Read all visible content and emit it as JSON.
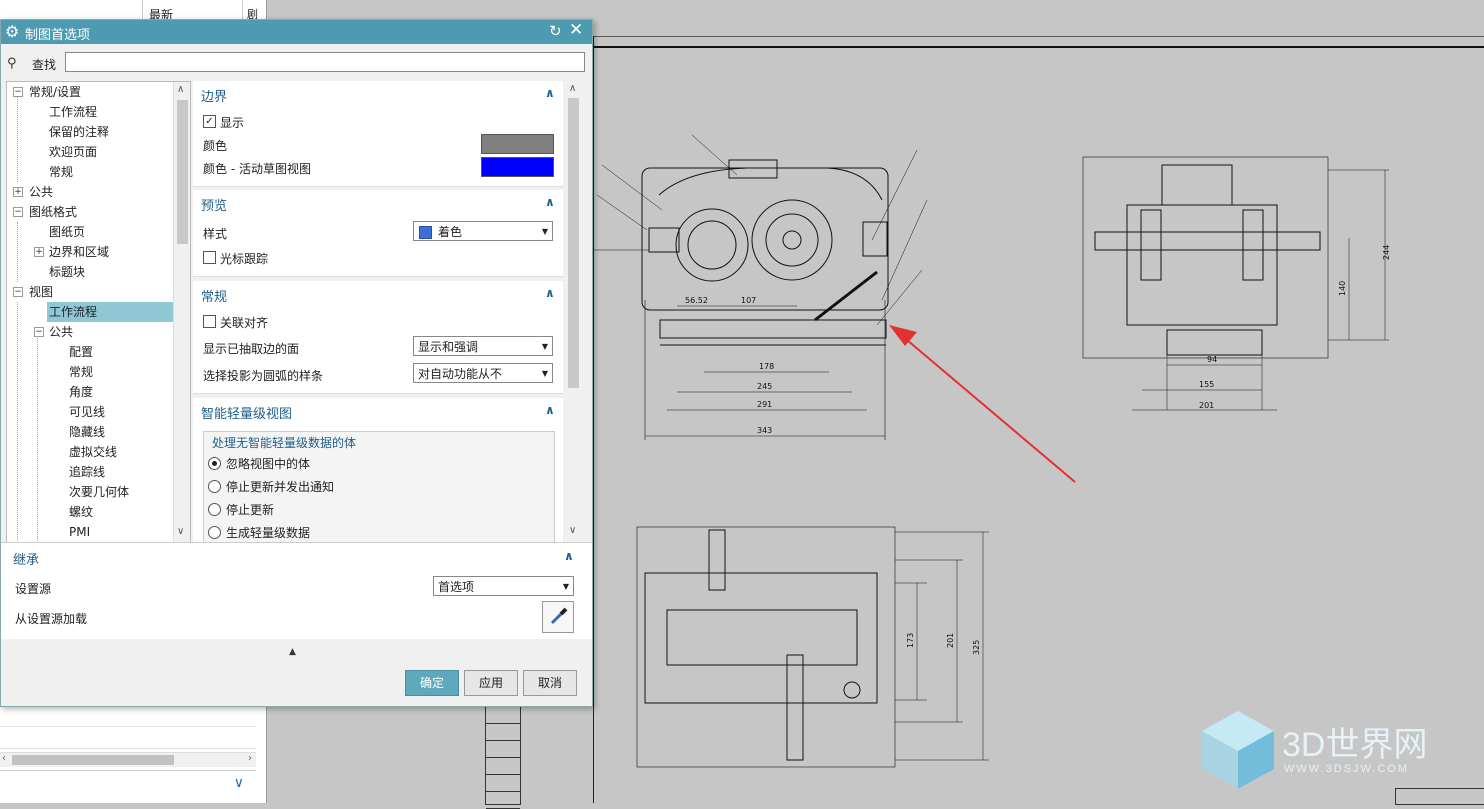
{
  "background_panel": {
    "column_header": "最新",
    "column_header_2": "剧"
  },
  "dialog": {
    "title": "制图首选项",
    "search_label": "查找",
    "search_value": "",
    "tree": [
      {
        "label": "常规/设置",
        "level": 0,
        "toggle": "-"
      },
      {
        "label": "工作流程",
        "level": 1
      },
      {
        "label": "保留的注释",
        "level": 1
      },
      {
        "label": "欢迎页面",
        "level": 1
      },
      {
        "label": "常规",
        "level": 1
      },
      {
        "label": "公共",
        "level": 0,
        "toggle": "+"
      },
      {
        "label": "图纸格式",
        "level": 0,
        "toggle": "-"
      },
      {
        "label": "图纸页",
        "level": 1
      },
      {
        "label": "边界和区域",
        "level": 1,
        "toggle": "+"
      },
      {
        "label": "标题块",
        "level": 1
      },
      {
        "label": "视图",
        "level": 0,
        "toggle": "-"
      },
      {
        "label": "工作流程",
        "level": 1,
        "selected": true
      },
      {
        "label": "公共",
        "level": 1,
        "toggle": "-"
      },
      {
        "label": "配置",
        "level": 2
      },
      {
        "label": "常规",
        "level": 2
      },
      {
        "label": "角度",
        "level": 2
      },
      {
        "label": "可见线",
        "level": 2
      },
      {
        "label": "隐藏线",
        "level": 2
      },
      {
        "label": "虚拟交线",
        "level": 2
      },
      {
        "label": "追踪线",
        "level": 2
      },
      {
        "label": "次要几何体",
        "level": 2
      },
      {
        "label": "螺纹",
        "level": 2
      },
      {
        "label": "PMI",
        "level": 2
      }
    ],
    "sections": {
      "border": {
        "title": "边界",
        "show_label": "显示",
        "show_checked": true,
        "color_label": "颜色",
        "color_value": "#808080",
        "active_color_label": "颜色 - 活动草图视图",
        "active_color_value": "#0000ff"
      },
      "preview": {
        "title": "预览",
        "style_label": "样式",
        "style_value": "着色",
        "cursor_label": "光标跟踪",
        "cursor_checked": false
      },
      "general": {
        "title": "常规",
        "align_label": "关联对齐",
        "align_checked": false,
        "extracted_label": "显示已抽取边的面",
        "extracted_value": "显示和强调",
        "spline_label": "选择投影为圆弧的样条",
        "spline_value": "对自动功能从不"
      },
      "lightweight": {
        "title": "智能轻量级视图",
        "group_title": "处理无智能轻量级数据的体",
        "options": [
          "忽略视图中的体",
          "停止更新并发出通知",
          "停止更新",
          "生成轻量级数据"
        ],
        "selected_index": 0
      }
    },
    "inherit": {
      "title": "继承",
      "source_label": "设置源",
      "source_value": "首选项",
      "load_label": "从设置源加载"
    },
    "buttons": {
      "ok": "确定",
      "apply": "应用",
      "cancel": "取消"
    }
  },
  "drawing": {
    "front_view_dims": [
      "56.52",
      "107",
      "178",
      "245",
      "291",
      "343"
    ],
    "side_view_dims": [
      "244",
      "140",
      "94",
      "155",
      "201"
    ],
    "top_view_dims": [
      "173",
      "201",
      "325"
    ],
    "arrow_color": "#e53030"
  },
  "watermark": {
    "brand": "3D世界网",
    "url": "WWW.3DSJW.COM"
  }
}
